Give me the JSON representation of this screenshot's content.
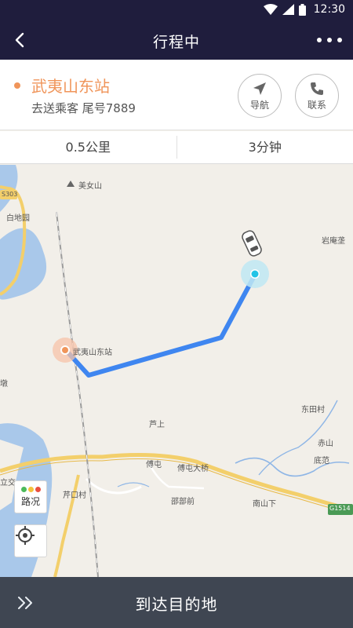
{
  "status_bar": {
    "time": "12:30"
  },
  "header": {
    "title": "行程中"
  },
  "destination": {
    "name": "武夷山东站",
    "subtitle": "去送乘客 尾号7889",
    "navigate_label": "导航",
    "contact_label": "联系"
  },
  "stats": {
    "distance": "0.5公里",
    "duration": "3分钟"
  },
  "map": {
    "labels": {
      "meinvshan": "美女山",
      "s303": "S303",
      "baidiyuan": "白地园",
      "yananyan": "岩庵垄",
      "station": "武夷山东站",
      "dun": "墩",
      "dongtiancun": "东田村",
      "lushang": "芦上",
      "chishan": "赤山",
      "difan": "底范",
      "futun": "傅屯",
      "futun_bridge": "傅屯大桥",
      "likou": "立交",
      "lukoucun": "芹口村",
      "shaobuqian": "邵部前",
      "nanshanxia": "南山下",
      "g1514": "G1514"
    },
    "traffic_label": "路况"
  },
  "bottom": {
    "arrive_label": "到达目的地"
  },
  "colors": {
    "header_bg": "#1f1d3d",
    "accent_orange": "#f0955a",
    "route_blue": "#3f86f0",
    "car_marker_cyan": "#22c3e6",
    "bottom_bar": "#3f4652"
  }
}
